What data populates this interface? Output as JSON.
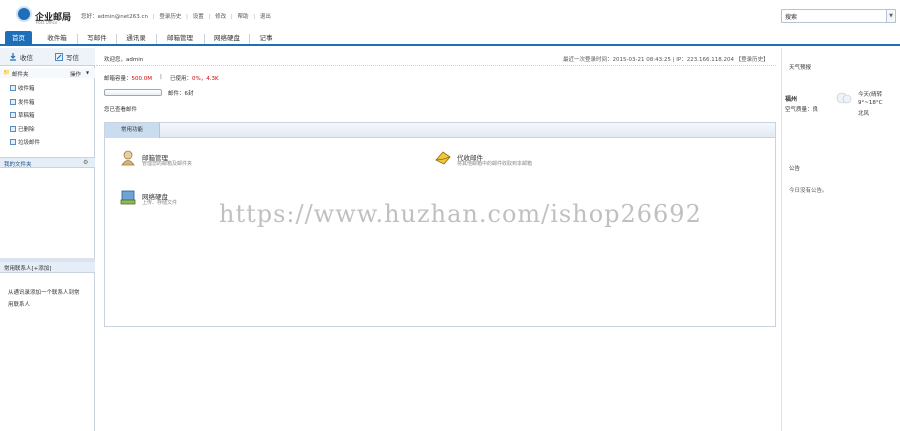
{
  "header": {
    "logo_title": "企业邮局",
    "logo_subtitle": "Post Office",
    "links": [
      "您好：admin@net263.cn",
      "|",
      "登录历史",
      "|",
      "设置",
      "|",
      "修改",
      "|",
      "帮助",
      "|",
      "退出"
    ],
    "search_value": "搜索"
  },
  "nav": {
    "tabs": [
      "首页",
      "收件箱",
      "写邮件",
      "通讯录",
      "邮箱管理",
      "网络硬盘",
      "记事"
    ]
  },
  "sidebar": {
    "receive_label": "收信",
    "compose_label": "写信",
    "mailbox_label": "邮件夹",
    "mailbox_action": "操作",
    "folders": [
      "收件箱",
      "发件箱",
      "草稿箱",
      "已删除",
      "垃圾邮件"
    ],
    "my_folders_label": "我的文件夹",
    "contacts_label": "常用联系人[+添加]",
    "contacts_hint_1": "从通讯录添加一个联系人到常",
    "contacts_hint_2": "用联系人"
  },
  "main": {
    "welcome": "欢迎您，admin",
    "last_login": "最近一次登录时间：2015-03-21 08:43:25 | IP：223.166.118.204 【登录历史】",
    "quota_label": "邮箱容量：",
    "quota_value": "500.0M",
    "used_label": "已使用：",
    "used_value": "0%，4.3K",
    "used_fraction": 0.0,
    "count_label": "邮件：6封",
    "unread_label": "您已查看邮件",
    "panel_tab": "常用功能",
    "apps": [
      {
        "title": "邮箱管理",
        "desc": "管理您的邮箱及邮件夹"
      },
      {
        "title": "代收邮件",
        "desc": "将其他邮箱中的邮件收取到本邮箱"
      },
      {
        "title": "网络硬盘",
        "desc": "上传、存储文件"
      }
    ]
  },
  "right": {
    "weather_title": "天气预报",
    "city": "福州",
    "air_label": "空气质量：良",
    "today_label": "今天(晴转",
    "today_temp": "9°~18°C",
    "today_wind": "北风",
    "notice_title": "公告",
    "notice_text": "今日没有公告。"
  },
  "watermark": "https://www.huzhan.com/ishop26692",
  "colors": {
    "accent": "#1f6fb8",
    "highlight_red": "#d00000",
    "border": "#c8d3df"
  }
}
